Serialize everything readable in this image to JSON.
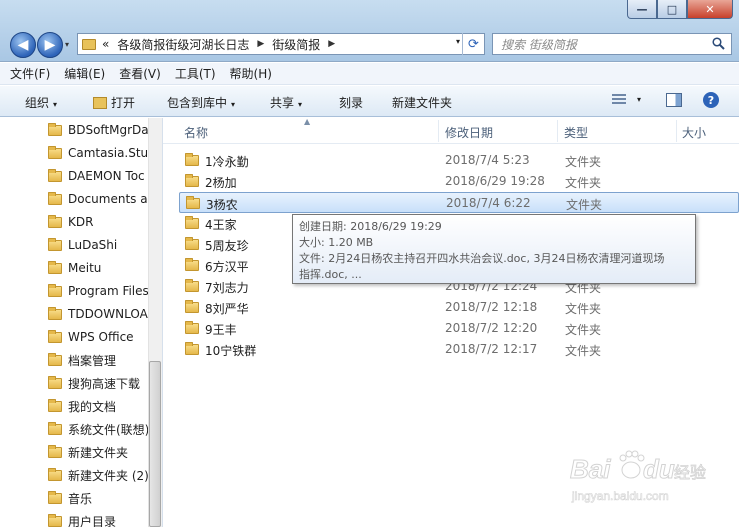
{
  "window": {
    "minimize_glyph": "—",
    "maximize_glyph": "□",
    "close_glyph": "✕"
  },
  "nav": {
    "back_glyph": "◀",
    "forward_glyph": "▶",
    "dropdown_glyph": "▾"
  },
  "address": {
    "prefix": "«",
    "crumbs": [
      "各级简报街级河湖长日志",
      "街级简报"
    ],
    "separator": "▶",
    "refresh_glyph": "⟳"
  },
  "search": {
    "placeholder": "搜索 街级简报"
  },
  "menu": {
    "items": [
      "文件(F)",
      "编辑(E)",
      "查看(V)",
      "工具(T)",
      "帮助(H)"
    ]
  },
  "toolbar": {
    "organize": "组织",
    "open": "打开",
    "include_in_library": "包含到库中",
    "share": "共享",
    "burn": "刻录",
    "new_folder": "新建文件夹",
    "caret": "▾",
    "help": "?"
  },
  "sidebar": {
    "items": [
      "BDSoftMgrDa",
      "Camtasia.Stuc",
      "DAEMON Toc",
      "Documents ar",
      "KDR",
      "LuDaShi",
      "Meitu",
      "Program Files",
      "TDDOWNLOA",
      "WPS Office",
      "档案管理",
      "搜狗高速下载",
      "我的文档",
      "系统文件(联想)",
      "新建文件夹",
      "新建文件夹 (2)",
      "音乐",
      "用户目录"
    ]
  },
  "columns": {
    "name": "名称",
    "date": "修改日期",
    "type": "类型",
    "size": "大小",
    "sort_glyph": "▲"
  },
  "files": [
    {
      "name": "1冷永勤",
      "date": "2018/7/4 5:23",
      "type": "文件夹"
    },
    {
      "name": "2杨加",
      "date": "2018/6/29 19:28",
      "type": "文件夹"
    },
    {
      "name": "3杨农",
      "date": "2018/7/4 6:22",
      "type": "文件夹"
    },
    {
      "name": "4王家",
      "date": "",
      "type": ""
    },
    {
      "name": "5周友珍",
      "date": "",
      "type": ""
    },
    {
      "name": "6方汉平",
      "date": "",
      "type": ""
    },
    {
      "name": "7刘志力",
      "date": "2018/7/2 12:24",
      "type": "文件夹"
    },
    {
      "name": "8刘严华",
      "date": "2018/7/2 12:18",
      "type": "文件夹"
    },
    {
      "name": "9王丰",
      "date": "2018/7/2 12:20",
      "type": "文件夹"
    },
    {
      "name": "10宁铁群",
      "date": "2018/7/2 12:17",
      "type": "文件夹"
    }
  ],
  "tooltip": {
    "created": "创建日期: 2018/6/29 19:29",
    "size": "大小: 1.20 MB",
    "files_line1": "文件: 2月24日杨农主持召开四水共治会议.doc, 3月24日杨农清理河道现场",
    "files_line2": "指挥.doc, ..."
  },
  "watermark": {
    "brand": "Baidu",
    "subtitle": "经验",
    "url": "jingyan.baidu.com"
  }
}
